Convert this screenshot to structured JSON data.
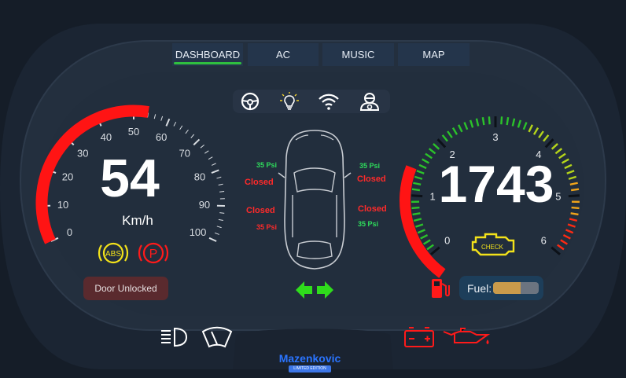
{
  "nav": {
    "tabs": [
      {
        "label": "DASHBOARD",
        "active": true
      },
      {
        "label": "AC",
        "active": false
      },
      {
        "label": "MUSIC",
        "active": false
      },
      {
        "label": "MAP",
        "active": false
      }
    ]
  },
  "top_icons": [
    "steering-wheel-icon",
    "light-bulb-icon",
    "wifi-icon",
    "driver-icon"
  ],
  "speedometer": {
    "value": "54",
    "unit": "Km/h",
    "ticks": [
      "0",
      "10",
      "20",
      "30",
      "40",
      "50",
      "60",
      "70",
      "80",
      "90",
      "100"
    ],
    "range": [
      0,
      100
    ]
  },
  "tachometer": {
    "value": "1743",
    "ticks": [
      "0",
      "1",
      "2",
      "3",
      "4",
      "5",
      "6"
    ],
    "range": [
      0,
      6
    ],
    "check_label": "CHECK"
  },
  "warnings": {
    "abs_label": "ABS",
    "parking_label": "P"
  },
  "door_status": "Door Unlocked",
  "tires": {
    "front_left": {
      "pressure": "35 Psi",
      "status": "Closed"
    },
    "front_right": {
      "pressure": "35 Psi",
      "status": "Closed"
    },
    "rear_left": {
      "pressure": "35 Psi",
      "status": "Closed"
    },
    "rear_right": {
      "pressure": "35 Psi",
      "status": "Closed"
    }
  },
  "fuel": {
    "label": "Fuel:",
    "level": 0.6
  },
  "brand": {
    "name": "Mazenkovic",
    "edition": "LIMITED EDITION"
  },
  "colors": {
    "background": "#151d28",
    "panel": "#212d3b",
    "accent_green": "#2fbf3f",
    "warning_red": "#ff1a1a",
    "warning_yellow": "#f3e21a",
    "tab_bg": "#24354b"
  }
}
